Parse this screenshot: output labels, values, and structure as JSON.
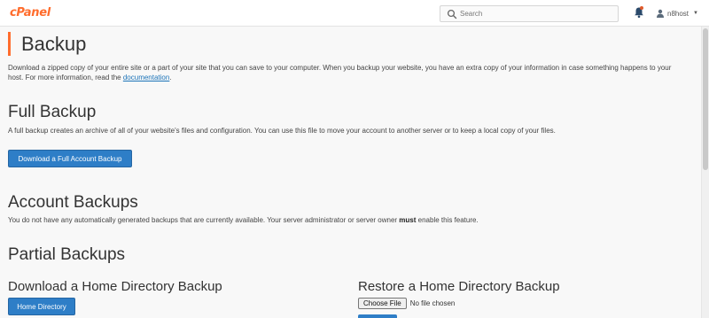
{
  "header": {
    "logo": "cPanel",
    "search_placeholder": "Search",
    "username": "n8host"
  },
  "page": {
    "title": "Backup",
    "intro_text": "Download a zipped copy of your entire site or a part of your site that you can save to your computer. When you backup your website, you have an extra copy of your information in case something happens to your host. For more information, read the ",
    "intro_link": "documentation",
    "intro_end": "."
  },
  "full_backup": {
    "heading": "Full Backup",
    "description": "A full backup creates an archive of all of your website's files and configuration. You can use this file to move your account to another server or to keep a local copy of your files.",
    "button": "Download a Full Account Backup"
  },
  "account_backups": {
    "heading": "Account Backups",
    "description_start": "You do not have any automatically generated backups that are currently available. Your server administrator or server owner ",
    "description_bold": "must",
    "description_end": " enable this feature."
  },
  "partial_backups": {
    "heading": "Partial Backups",
    "download_heading": "Download a Home Directory Backup",
    "download_button": "Home Directory",
    "restore_heading": "Restore a Home Directory Backup",
    "choose_file_button": "Choose File",
    "no_file_text": "No file chosen"
  },
  "colors": {
    "accent": "#ff6c2c",
    "primary_button": "#2e7ec7",
    "link": "#1b73b8",
    "background": "#f8f8f8"
  }
}
